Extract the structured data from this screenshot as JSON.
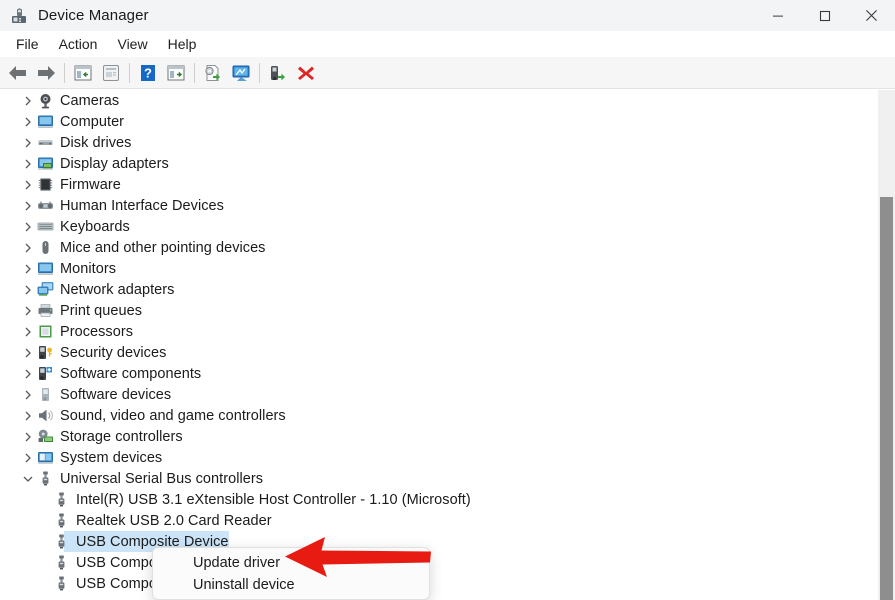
{
  "window": {
    "title": "Device Manager",
    "icon": "device-manager-icon",
    "controls": [
      {
        "name": "minimize",
        "glyph": "minimize-icon"
      },
      {
        "name": "maximize",
        "glyph": "maximize-icon"
      },
      {
        "name": "close",
        "glyph": "close-icon"
      }
    ]
  },
  "menubar": {
    "items": [
      {
        "label": "File"
      },
      {
        "label": "Action"
      },
      {
        "label": "View"
      },
      {
        "label": "Help"
      }
    ]
  },
  "toolbar": {
    "buttons": [
      {
        "name": "back-button",
        "icon": "back-arrow-icon"
      },
      {
        "name": "forward-button",
        "icon": "forward-arrow-icon"
      },
      {
        "name": "show-hide-console-tree-button",
        "icon": "console-tree-icon"
      },
      {
        "name": "properties-button",
        "icon": "properties-icon"
      },
      {
        "name": "help-button",
        "icon": "help-question-icon"
      },
      {
        "name": "show-hide-action-pane-button",
        "icon": "action-pane-icon"
      },
      {
        "name": "update-driver-button",
        "icon": "update-driver-icon"
      },
      {
        "name": "scan-hardware-changes-button",
        "icon": "scan-monitor-icon"
      },
      {
        "name": "uninstall-device-button",
        "icon": "uninstall-device-icon"
      },
      {
        "name": "disable-device-button",
        "icon": "red-x-icon"
      }
    ]
  },
  "tree": {
    "nodes": [
      {
        "label": "Cameras",
        "depth": 0,
        "expanded": false,
        "icon": "camera-icon",
        "selected": false
      },
      {
        "label": "Computer",
        "depth": 0,
        "expanded": false,
        "icon": "computer-icon",
        "selected": false
      },
      {
        "label": "Disk drives",
        "depth": 0,
        "expanded": false,
        "icon": "disk-drive-icon",
        "selected": false
      },
      {
        "label": "Display adapters",
        "depth": 0,
        "expanded": false,
        "icon": "display-adapter-icon",
        "selected": false
      },
      {
        "label": "Firmware",
        "depth": 0,
        "expanded": false,
        "icon": "firmware-icon",
        "selected": false
      },
      {
        "label": "Human Interface Devices",
        "depth": 0,
        "expanded": false,
        "icon": "hid-icon",
        "selected": false
      },
      {
        "label": "Keyboards",
        "depth": 0,
        "expanded": false,
        "icon": "keyboard-icon",
        "selected": false
      },
      {
        "label": "Mice and other pointing devices",
        "depth": 0,
        "expanded": false,
        "icon": "mouse-icon",
        "selected": false
      },
      {
        "label": "Monitors",
        "depth": 0,
        "expanded": false,
        "icon": "monitor-icon",
        "selected": false
      },
      {
        "label": "Network adapters",
        "depth": 0,
        "expanded": false,
        "icon": "network-adapter-icon",
        "selected": false
      },
      {
        "label": "Print queues",
        "depth": 0,
        "expanded": false,
        "icon": "printer-icon",
        "selected": false
      },
      {
        "label": "Processors",
        "depth": 0,
        "expanded": false,
        "icon": "processor-icon",
        "selected": false
      },
      {
        "label": "Security devices",
        "depth": 0,
        "expanded": false,
        "icon": "security-device-icon",
        "selected": false
      },
      {
        "label": "Software components",
        "depth": 0,
        "expanded": false,
        "icon": "software-component-icon",
        "selected": false
      },
      {
        "label": "Software devices",
        "depth": 0,
        "expanded": false,
        "icon": "software-device-icon",
        "selected": false
      },
      {
        "label": "Sound, video and game controllers",
        "depth": 0,
        "expanded": false,
        "icon": "speaker-icon",
        "selected": false
      },
      {
        "label": "Storage controllers",
        "depth": 0,
        "expanded": false,
        "icon": "storage-controller-icon",
        "selected": false
      },
      {
        "label": "System devices",
        "depth": 0,
        "expanded": false,
        "icon": "system-device-icon",
        "selected": false
      },
      {
        "label": "Universal Serial Bus controllers",
        "depth": 0,
        "expanded": true,
        "icon": "usb-icon",
        "selected": false
      },
      {
        "label": "Intel(R) USB 3.1 eXtensible Host Controller - 1.10 (Microsoft)",
        "depth": 1,
        "expanded": null,
        "icon": "usb-icon",
        "selected": false
      },
      {
        "label": "Realtek USB 2.0 Card Reader",
        "depth": 1,
        "expanded": null,
        "icon": "usb-icon",
        "selected": false
      },
      {
        "label": "USB Composite Device",
        "depth": 1,
        "expanded": null,
        "icon": "usb-icon",
        "selected": true
      },
      {
        "label": "USB Composite Device",
        "depth": 1,
        "expanded": null,
        "icon": "usb-icon",
        "selected": false
      },
      {
        "label": "USB Composite Device",
        "depth": 1,
        "expanded": null,
        "icon": "usb-icon",
        "selected": false
      }
    ]
  },
  "context_menu": {
    "items": [
      {
        "label": "Update driver"
      },
      {
        "label": "Uninstall device"
      }
    ]
  },
  "annotation": {
    "arrow": "red-left-arrow",
    "color": "#e81b12"
  },
  "colors": {
    "titlebar_bg": "#f3f4f6",
    "toolbar_bg": "#f6f6f6",
    "selection_bg": "#cce4f7",
    "tree_bg": "#ffffff",
    "scrollbar_thumb": "#8e8e8e",
    "scrollbar_track": "#f0f0f0",
    "arrow_red": "#e81b12",
    "text": "#1b1b1b"
  }
}
